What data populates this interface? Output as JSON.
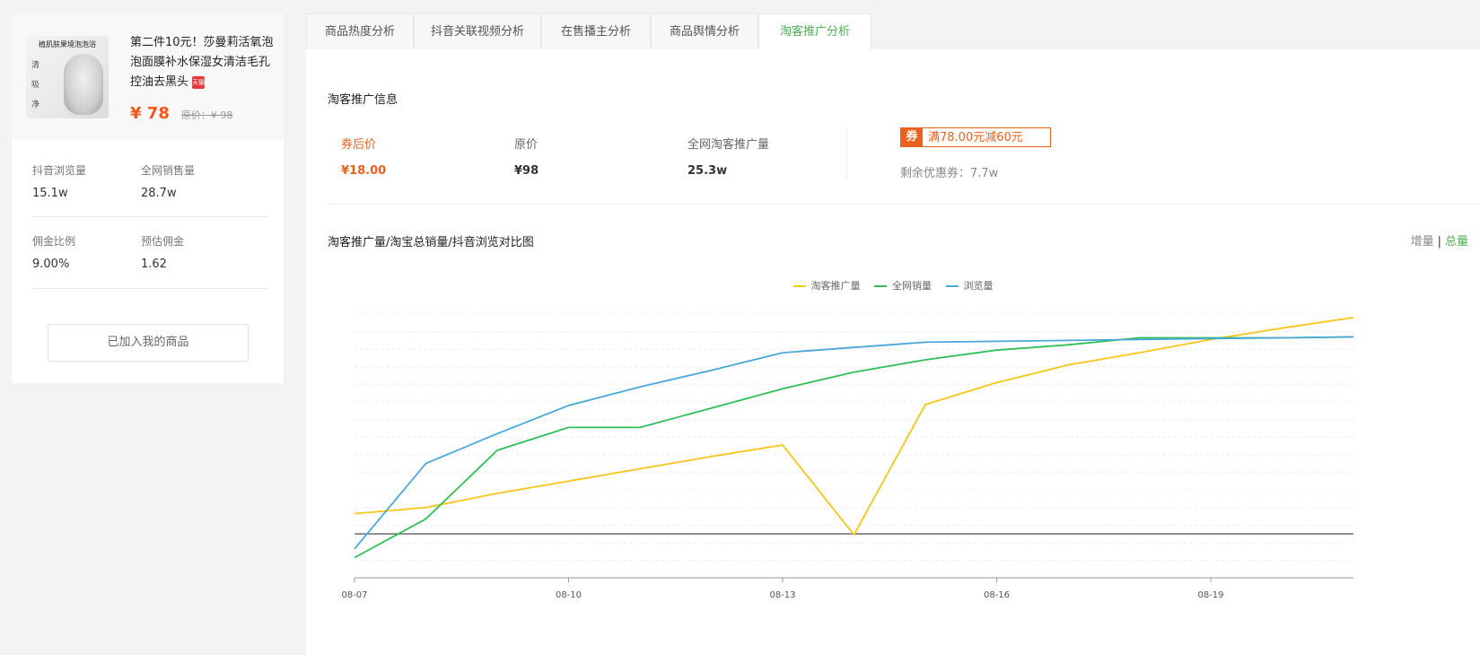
{
  "product": {
    "thumb_caption": "植肌肤果境泡泡浴",
    "thumb_chars": [
      "清",
      "吸",
      "净"
    ],
    "title": "第二件10元！莎曼莉活氧泡泡面膜补水保湿女清洁毛孔控油去黑头",
    "tmall_badge": "天猫",
    "price_now": "¥ 78",
    "price_orig": "原价：¥ 98"
  },
  "stats": {
    "douyin_views_label": "抖音浏览量",
    "douyin_views_value": "15.1w",
    "total_sales_label": "全网销售量",
    "total_sales_value": "28.7w",
    "commission_rate_label": "佣金比例",
    "commission_rate_value": "9.00%",
    "est_commission_label": "预估佣金",
    "est_commission_value": "1.62"
  },
  "added_button": "已加入我的商品",
  "tabs": [
    {
      "label": "商品热度分析"
    },
    {
      "label": "抖音关联视频分析"
    },
    {
      "label": "在售播主分析"
    },
    {
      "label": "商品舆情分析"
    },
    {
      "label": "淘客推广分析",
      "active": true
    }
  ],
  "info": {
    "title": "淘客推广信息",
    "after_coupon_label": "券后价",
    "after_coupon_value": "¥18.00",
    "orig_label": "原价",
    "orig_value": "¥98",
    "promo_label": "全网淘客推广量",
    "promo_value": "25.3w",
    "coupon_tag": "券",
    "coupon_text": "满78.00元减60元",
    "coupon_remain": "剩余优惠券：7.7w"
  },
  "chart_section": {
    "title": "淘客推广量/淘宝总销量/抖音浏览对比图",
    "toggle_incr": "增量",
    "toggle_sep": "|",
    "toggle_total": "总量"
  },
  "colors": {
    "yellow": "#f5c518",
    "green": "#2fbf5a",
    "blue": "#4aa7d8",
    "accent": "#e8621e",
    "active_tab": "#4caf50"
  },
  "chart_data": {
    "type": "line",
    "x": [
      "08-07",
      "08-08",
      "08-09",
      "08-10",
      "08-11",
      "08-12",
      "08-13",
      "08-14",
      "08-15",
      "08-16",
      "08-17",
      "08-18",
      "08-19",
      "08-20",
      "08-21"
    ],
    "xtick_labels": [
      "08-07",
      "08-10",
      "08-13",
      "08-16",
      "08-19"
    ],
    "series": [
      {
        "name": "淘客推广量",
        "color": "#f5c518",
        "values": [
          2.3,
          3.0,
          4.6,
          6.0,
          7.4,
          8.8,
          10.1,
          -0.1,
          14.7,
          17.2,
          19.2,
          20.6,
          22.1,
          23.4,
          24.6
        ]
      },
      {
        "name": "全网销量",
        "color": "#2fbf5a",
        "values": [
          -2.7,
          1.7,
          9.5,
          12.1,
          12.1,
          14.3,
          16.5,
          18.4,
          19.8,
          20.9,
          21.5,
          22.3,
          22.3,
          22.3,
          22.4
        ]
      },
      {
        "name": "浏览量",
        "color": "#4aa7d8",
        "values": [
          -1.7,
          8.0,
          11.4,
          14.6,
          16.7,
          18.6,
          20.6,
          21.2,
          21.8,
          21.9,
          22.0,
          22.1,
          22.2,
          22.3,
          22.4
        ]
      }
    ],
    "ylim": [
      -5,
      25
    ],
    "grid": true,
    "legend": "top-center"
  }
}
